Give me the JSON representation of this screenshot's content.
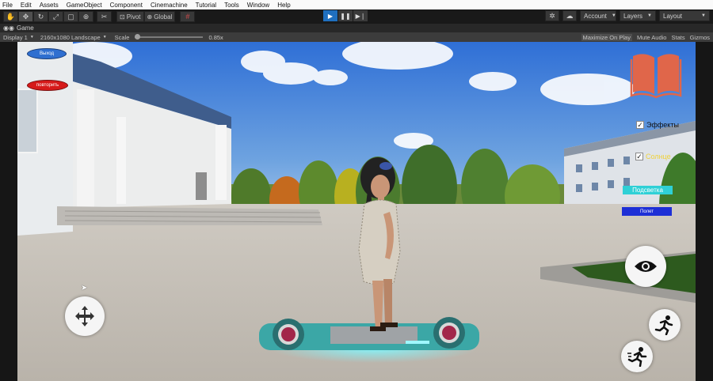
{
  "menu": [
    "File",
    "Edit",
    "Assets",
    "GameObject",
    "Component",
    "Cinemachine",
    "Tutorial",
    "Tools",
    "Window",
    "Help"
  ],
  "toolbar": {
    "tools": [
      "hand-icon",
      "move-icon",
      "rotate-icon",
      "scale-icon",
      "rect-icon",
      "transform-icon",
      "custom-tool-icon"
    ],
    "pivot_label": "Pivot",
    "global_label": "Global",
    "account_label": "Account",
    "layers_label": "Layers",
    "layout_label": "Layout"
  },
  "tab": {
    "label": "Game"
  },
  "gamebar": {
    "display": "Display 1",
    "resolution": "2160x1080 Landscape",
    "scale_label": "Scale",
    "scale_value": "0.85x",
    "maximize": "Maximize On Play",
    "mute": "Mute Audio",
    "stats": "Stats",
    "gizmos": "Gizmos"
  },
  "hud": {
    "exit_label": "Выход",
    "repeat_label": "повторить",
    "effects_label": "Эффекты",
    "sun_label": "Солнце",
    "highlight_label": "Подсветка",
    "flight_label": "Полет"
  },
  "colors": {
    "exit": "#2f6fd0",
    "repeat": "#d61a1a",
    "book": "#e0664a",
    "sun_text": "#f0d23a",
    "highlight_bg": "#2fd0d6",
    "flight_bg": "#1d2fd6",
    "play_active": "#1f6fbf"
  }
}
